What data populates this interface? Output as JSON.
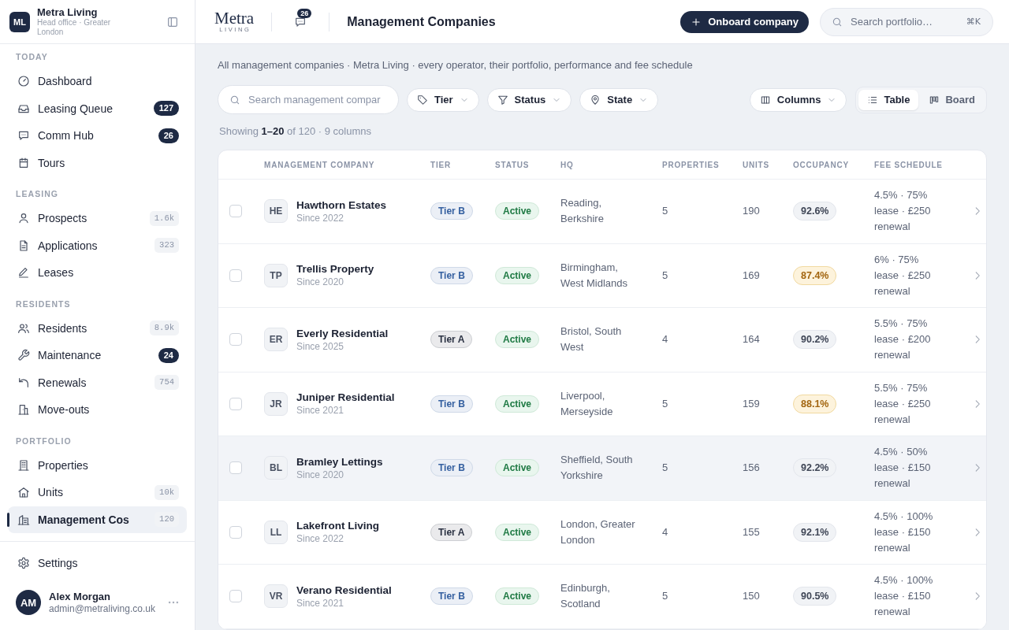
{
  "sidebar": {
    "org": {
      "initials": "ML",
      "name": "Metra Living",
      "subtitle": "Head office · Greater London"
    },
    "sections": [
      {
        "title": "TODAY",
        "items": [
          {
            "label": "Dashboard",
            "selected": false
          },
          {
            "label": "Leasing Queue",
            "selected": false,
            "badge": {
              "label": "127",
              "kind": "alert"
            }
          },
          {
            "label": "Comm Hub",
            "selected": false,
            "badge": {
              "label": "26",
              "kind": "alert"
            }
          },
          {
            "label": "Tours",
            "selected": false
          }
        ]
      },
      {
        "title": "LEASING",
        "items": [
          {
            "label": "Prospects",
            "selected": false,
            "badge": {
              "label": "1.6k",
              "kind": "muted"
            }
          },
          {
            "label": "Applications",
            "selected": false,
            "badge": {
              "label": "323",
              "kind": "muted"
            }
          },
          {
            "label": "Leases",
            "selected": false
          }
        ]
      },
      {
        "title": "RESIDENTS",
        "items": [
          {
            "label": "Residents",
            "selected": false,
            "badge": {
              "label": "8.9k",
              "kind": "muted"
            }
          },
          {
            "label": "Maintenance",
            "selected": false,
            "badge": {
              "label": "24",
              "kind": "alert"
            }
          },
          {
            "label": "Renewals",
            "selected": false,
            "badge": {
              "label": "754",
              "kind": "muted"
            }
          },
          {
            "label": "Move-outs",
            "selected": false
          }
        ]
      },
      {
        "title": "PORTFOLIO",
        "items": [
          {
            "label": "Properties",
            "selected": false
          },
          {
            "label": "Units",
            "selected": false,
            "badge": {
              "label": "10k",
              "kind": "muted"
            }
          },
          {
            "label": "Management Cos",
            "selected": true,
            "badge": {
              "label": "120",
              "kind": "muted"
            }
          }
        ]
      }
    ],
    "settings": {
      "label": "Settings",
      "selected": false
    },
    "user": {
      "initials": "AM",
      "name": "Alex Morgan",
      "email": "admin@metraliving.co.uk"
    }
  },
  "header": {
    "logo": {
      "name": "Metra",
      "tagline": "LIVING"
    },
    "messages_badge": "26",
    "title": "Management Companies",
    "primary_action": "Onboard company",
    "search": {
      "placeholder": "Search portfolio…",
      "shortcut": "⌘K"
    }
  },
  "page": {
    "description": "All management companies · Metra Living · every operator, their portfolio, performance and fee schedule",
    "search": {
      "placeholder": "Search management compar"
    },
    "filters": [
      {
        "label": "Tier"
      },
      {
        "label": "Status"
      },
      {
        "label": "State"
      }
    ],
    "columns_button": "Columns",
    "views": [
      {
        "label": "Table",
        "selected": true
      },
      {
        "label": "Board",
        "selected": false
      }
    ],
    "summary": "Showing **1–20** of 120 · 9 columns"
  },
  "table": {
    "columns": [
      "MANAGEMENT COMPANY",
      "TIER",
      "STATUS",
      "HQ",
      "PROPERTIES",
      "UNITS",
      "OCCUPANCY",
      "FEE SCHEDULE"
    ],
    "rows": [
      {
        "checked": false,
        "hovered": false,
        "initials": "HE",
        "name": "Hawthorn Estates",
        "since": "Since 2022",
        "tier": {
          "label": "Tier B",
          "color": "#3560a0"
        },
        "status": "Active",
        "hq": "Reading, Berkshire",
        "properties": "5",
        "units": "190",
        "occupancy": {
          "label": "92.6%",
          "warning": false
        },
        "fee_schedule": "4.5% · 75% lease · £250 renewal"
      },
      {
        "checked": false,
        "hovered": false,
        "initials": "TP",
        "name": "Trellis Property",
        "since": "Since 2020",
        "tier": {
          "label": "Tier B",
          "color": "#3560a0"
        },
        "status": "Active",
        "hq": "Birmingham, West Midlands",
        "properties": "5",
        "units": "169",
        "occupancy": {
          "label": "87.4%",
          "warning": true
        },
        "fee_schedule": "6% · 75% lease · £250 renewal"
      },
      {
        "checked": false,
        "hovered": false,
        "initials": "ER",
        "name": "Everly Residential",
        "since": "Since 2025",
        "tier": {
          "label": "Tier A",
          "color": "#2a3142"
        },
        "status": "Active",
        "hq": "Bristol, South West",
        "properties": "4",
        "units": "164",
        "occupancy": {
          "label": "90.2%",
          "warning": false
        },
        "fee_schedule": "5.5% · 75% lease · £200 renewal"
      },
      {
        "checked": false,
        "hovered": false,
        "initials": "JR",
        "name": "Juniper Residential",
        "since": "Since 2021",
        "tier": {
          "label": "Tier B",
          "color": "#3560a0"
        },
        "status": "Active",
        "hq": "Liverpool, Merseyside",
        "properties": "5",
        "units": "159",
        "occupancy": {
          "label": "88.1%",
          "warning": true
        },
        "fee_schedule": "5.5% · 75% lease · £250 renewal"
      },
      {
        "checked": false,
        "hovered": true,
        "initials": "BL",
        "name": "Bramley Lettings",
        "since": "Since 2020",
        "tier": {
          "label": "Tier B",
          "color": "#3560a0"
        },
        "status": "Active",
        "hq": "Sheffield, South Yorkshire",
        "properties": "5",
        "units": "156",
        "occupancy": {
          "label": "92.2%",
          "warning": false
        },
        "fee_schedule": "4.5% · 50% lease · £150 renewal"
      },
      {
        "checked": false,
        "hovered": false,
        "initials": "LL",
        "name": "Lakefront Living",
        "since": "Since 2022",
        "tier": {
          "label": "Tier A",
          "color": "#2a3142"
        },
        "status": "Active",
        "hq": "London, Greater London",
        "properties": "4",
        "units": "155",
        "occupancy": {
          "label": "92.1%",
          "warning": false
        },
        "fee_schedule": "4.5% · 100% lease · £150 renewal"
      },
      {
        "checked": false,
        "hovered": false,
        "initials": "VR",
        "name": "Verano Residential",
        "since": "Since 2021",
        "tier": {
          "label": "Tier B",
          "color": "#3560a0"
        },
        "status": "Active",
        "hq": "Edinburgh, Scotland",
        "properties": "5",
        "units": "150",
        "occupancy": {
          "label": "90.5%",
          "warning": false
        },
        "fee_schedule": "4.5% · 100% lease · £150 renewal"
      }
    ]
  }
}
